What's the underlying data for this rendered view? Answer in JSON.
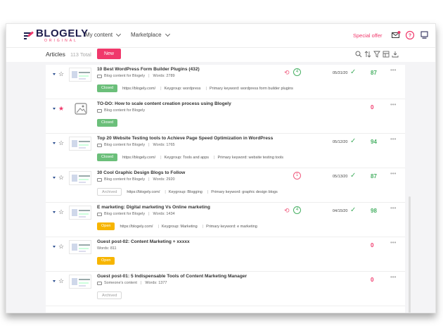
{
  "header": {
    "logo_main": "BLOGELY",
    "logo_sub": "ORIGINAL",
    "nav_content": "My content",
    "nav_marketplace": "Marketplace",
    "special_offer": "Special offer",
    "icons": [
      "mail-icon",
      "help-icon",
      "profile-icon"
    ]
  },
  "toolbar": {
    "title": "Articles",
    "total": "113 Total",
    "new_label": "New",
    "icons": [
      "search-icon",
      "sort-icon",
      "filter-icon",
      "columns-icon",
      "download-icon"
    ]
  },
  "colors": {
    "accent": "#f0386b",
    "green": "#48b064",
    "brand_dark": "#1d1d4d"
  },
  "rows": [
    {
      "title": "10 Best WordPress Form Builder Plugins (432)",
      "category": "Blog content for Blogely",
      "words": "Words: 2789",
      "status": "Closed",
      "url": "https://blogely.com/",
      "keygroup": "Keygroup: wordpress",
      "primary": "Primary keyword: wordpress form builder plugins",
      "revision": "4",
      "date": "05/31/20",
      "score": "87",
      "starred": false
    },
    {
      "title": "TO-DO: How to scale content creation process using Blogely",
      "category": "Blog content for Blogely",
      "words": "",
      "status": "Closed",
      "url": "",
      "keygroup": "",
      "primary": "",
      "revision": "",
      "date": "",
      "score": "0",
      "starred": true
    },
    {
      "title": "Top 20 Website Testing tools to Achieve Page Speed Optimization in WordPress",
      "category": "Blog content for Blogely",
      "words": "Words: 1765",
      "status": "Closed",
      "url": "https://blogely.com/",
      "keygroup": "Keygroup: Tools and apps",
      "primary": "Primary keyword: website testing tools",
      "revision": "",
      "date": "05/12/20",
      "score": "94",
      "starred": false
    },
    {
      "title": "30 Cool Graphic Design Blogs to Follow",
      "category": "Blog content for Blogely",
      "words": "Words: 2920",
      "status": "Archived",
      "url": "https://blogely.com/",
      "keygroup": "Keygroup: Blogging",
      "primary": "Primary keyword: graphic design blogs",
      "revision": "1",
      "date": "05/13/20",
      "score": "87",
      "starred": false
    },
    {
      "title": "E marketing: Digital marketing Vs Online marketing",
      "category": "Blog content for Blogely",
      "words": "Words: 1434",
      "status": "Open",
      "url": "https://blogely.com/",
      "keygroup": "Keygroup: Marketing",
      "primary": "Primary keyword: e marketing",
      "revision": "4",
      "date": "04/15/20",
      "score": "98",
      "starred": false
    },
    {
      "title": "Guest post-02: Content Marketing + xxxxx",
      "category": "",
      "words": "Words: 811",
      "status": "Open",
      "url": "",
      "keygroup": "",
      "primary": "",
      "revision": "",
      "date": "",
      "score": "0",
      "starred": false
    },
    {
      "title": "Guest post-01: 5 Indispensable Tools of Content Marketing Manager",
      "category": "Someone's content",
      "words": "Words: 1377",
      "status": "Archived",
      "url": "",
      "keygroup": "",
      "primary": "",
      "revision": "",
      "date": "",
      "score": "0",
      "starred": false
    }
  ]
}
